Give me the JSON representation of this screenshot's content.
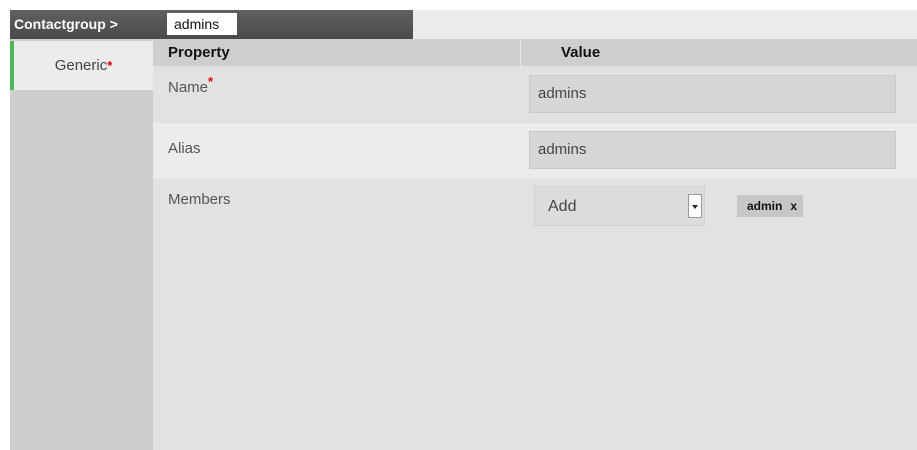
{
  "title": {
    "breadcrumb": "Contactgroup >",
    "name": "admins"
  },
  "tabs": [
    {
      "label": "Generic",
      "required_mark": "*",
      "active": true
    }
  ],
  "table": {
    "header_property": "Property",
    "header_value": "Value"
  },
  "fields": {
    "name": {
      "label": "Name",
      "required_mark": "*",
      "value": "admins"
    },
    "alias": {
      "label": "Alias",
      "value": "admins"
    },
    "members": {
      "label": "Members",
      "select_value": "Add",
      "tags": [
        {
          "label": "admin",
          "remove": "x"
        }
      ]
    }
  },
  "colors": {
    "active_tab_accent": "#4cb85a",
    "required_mark": "#e00000",
    "title_bar": "#4a4a4a"
  }
}
